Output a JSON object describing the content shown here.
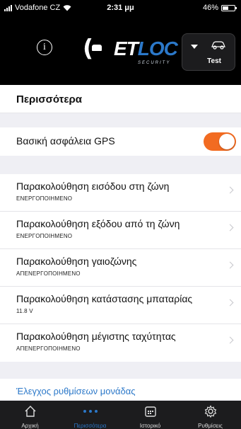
{
  "status_bar": {
    "carrier": "Vodafone CZ",
    "time": "2:31 μμ",
    "battery": "46%"
  },
  "header": {
    "logo_prefix": "E",
    "logo_t": "T",
    "logo_loc": "LOC",
    "logo_tagline": "SECURITY",
    "vehicle_label": "Test"
  },
  "page": {
    "title": "Περισσότερα"
  },
  "gps": {
    "label": "Βασική ασφάλεια GPS",
    "enabled": true,
    "accent_color": "#f26b21"
  },
  "items": [
    {
      "title": "Παρακολούθηση εισόδου στη ζώνη",
      "subtitle": "ΕΝΕΡΓΟΠΟΙΗΜΕΝΟ"
    },
    {
      "title": "Παρακολούθηση εξόδου από τη ζώνη",
      "subtitle": "ΕΝΕΡΓΟΠΟΙΗΜΕΝΟ"
    },
    {
      "title": "Παρακολούθηση γαιοζώνης",
      "subtitle": "ΑΠΕΝΕΡΓΟΠΟΙΗΜΕΝΟ"
    },
    {
      "title": "Παρακολούθηση κατάστασης μπαταρίας",
      "subtitle": "11.8 V"
    },
    {
      "title": "Παρακολούθηση μέγιστης ταχύτητας",
      "subtitle": "ΑΠΕΝΕΡΓΟΠΟΙΗΜΕΝΟ"
    }
  ],
  "link": {
    "label": "Έλεγχος ρυθμίσεων μονάδας",
    "color": "#2b78c9"
  },
  "tabs": [
    {
      "label": "Αρχική",
      "icon": "home-icon"
    },
    {
      "label": "Περισσότερα",
      "icon": "more-dots-icon",
      "active": true
    },
    {
      "label": "Ιστορικό",
      "icon": "calendar-icon"
    },
    {
      "label": "Ρυθμίσεις",
      "icon": "gear-icon"
    }
  ]
}
